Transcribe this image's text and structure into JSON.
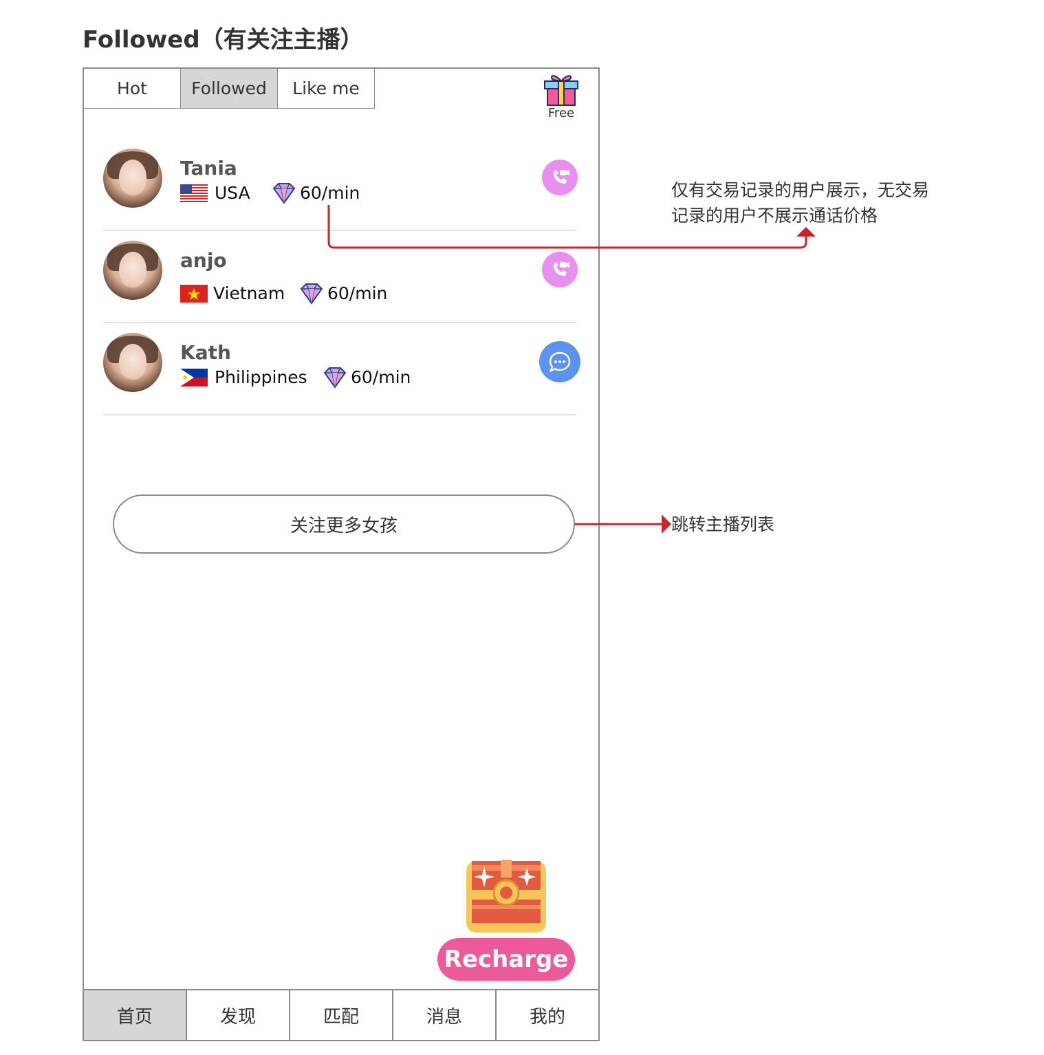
{
  "page_title": "Followed（有关注主播）",
  "tabs": [
    {
      "label": "Hot"
    },
    {
      "label": "Followed",
      "active": true
    },
    {
      "label": "Like me"
    }
  ],
  "gift": {
    "label": "Free",
    "icon": "gift-icon"
  },
  "anchors": [
    {
      "name": "Tania",
      "country": "USA",
      "flag": "usa-flag-icon",
      "price": "60/min",
      "action": "video-call-icon",
      "action_color": "#e98ff0"
    },
    {
      "name": "anjo",
      "country": "Vietnam",
      "flag": "vietnam-flag-icon",
      "price": "60/min",
      "action": "video-call-icon",
      "action_color": "#e98ff0"
    },
    {
      "name": "Kath",
      "country": "Philippines",
      "flag": "philippines-flag-icon",
      "price": "60/min",
      "action": "chat-icon",
      "action_color": "#5b93ee"
    }
  ],
  "follow_more_label": "关注更多女孩",
  "recharge_label": "Recharge",
  "bottom_nav": [
    {
      "label": "首页",
      "active": true
    },
    {
      "label": "发现"
    },
    {
      "label": "匹配"
    },
    {
      "label": "消息"
    },
    {
      "label": "我的"
    }
  ],
  "annotations": {
    "price_note_line1": "仅有交易记录的用户展示，无交易",
    "price_note_line2": "记录的用户不展示通话价格",
    "jump_note": "跳转主播列表"
  },
  "colors": {
    "accent_pink": "#ec5a99",
    "annotation_red": "#c8242b",
    "call_pink": "#e98ff0",
    "chat_blue": "#5b93ee"
  }
}
